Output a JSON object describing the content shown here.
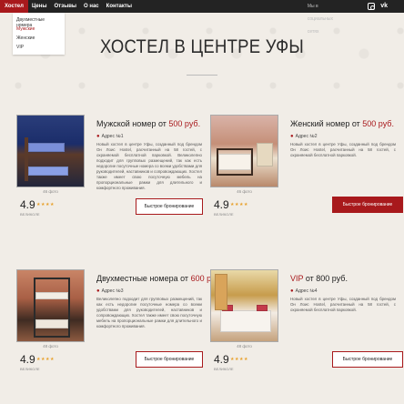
{
  "nav": {
    "items": [
      "Хостел",
      "Цены",
      "Отзывы",
      "О нас",
      "Контакты"
    ],
    "active_index": 0,
    "social_label": "Мы в социальных сетях",
    "vk_label": "vk"
  },
  "dropdown": {
    "items": [
      "Двухместные номера",
      "Мужские",
      "Женские",
      "VIP"
    ],
    "active_index": 1
  },
  "page_title": "ХОСТЕЛ В ЦЕНТРЕ УФЫ",
  "cards": [
    {
      "title_prefix": "Мужской номер от ",
      "price": "500 руб.",
      "title_suffix": "",
      "address": "Адрес №1",
      "description": "Новый хостел в центре Уфы, созданный под брендом Он Лоис Hostel, расчитанный на 58 гостей, с охраняемой бесплатной парковкой. Великолепно подходит для групповых размещений, так как есть недорогие посуточные номера со всеми удобствами для руководителей, наставников и сопровождающих. Хостел также имеет свою посуточную мебель на пропорциональные рамки для длительного и комфортного проживания.",
      "photos": "46 фото",
      "rating": "4.9",
      "rating_label": "ВЕЛИКОЛЕ",
      "stars": "★★★★",
      "button": "Быстрое бронирование"
    },
    {
      "title_prefix": "Женский номер от ",
      "price": "500 руб.",
      "title_suffix": "",
      "address": "Адрес №2",
      "description": "Новый хостел в центре Уфы, созданный под брендом Он Лоис Hostel, расчитанный на 58 гостей, с охраняемой бесплатной парковкой.",
      "photos": "46 фото",
      "rating": "4.9",
      "rating_label": "ВЕЛИКОЛЕ",
      "stars": "★★★★",
      "button": "Быстрое бронирование"
    },
    {
      "title_prefix": "Двухместные номера от ",
      "price": "600 руб.",
      "title_suffix": "",
      "address": "Адрес №3",
      "description": "Великолепно подходит для групповых размещений, так как есть недорогие посуточные номера со всеми удобствами для руководителей, наставников и сопровождающих. Хостел также имеет свою посуточную мебель на пропорциональные рамки для длительного и комфортного проживания.",
      "photos": "48 фото",
      "rating": "4.9",
      "rating_label": "ВЕЛИКОЛЕ",
      "stars": "★★★★",
      "button": "Быстрое бронирование"
    },
    {
      "title_prefix": "VIP",
      "price": "",
      "title_suffix": " от 800 руб.",
      "address": "Адрес №4",
      "description": "Новый хостел в центре Уфы, созданный под брендом Он Лоис Hostel, расчитанный на 58 гостей, с охраняемой бесплатной парковкой.",
      "photos": "48 фото",
      "rating": "4.9",
      "rating_label": "ВЕЛИКОЛЕ",
      "stars": "★★★★",
      "button": "Быстрое бронирование"
    }
  ],
  "colors": {
    "accent": "#a8191c",
    "background": "#f1ede7",
    "topbar": "#232323",
    "stars": "#e8a02a"
  }
}
